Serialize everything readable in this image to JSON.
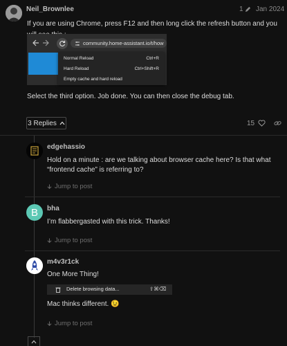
{
  "post": {
    "username": "Neil_Brownlee",
    "edit_count": "1",
    "date": "Jan 2024",
    "intro": "If you are using Chrome, press F12 and then long click the refresh button and you will see this :",
    "screenshot": {
      "url": "community.home-assistant.io/t/how",
      "menu": [
        {
          "label": "Normal Reload",
          "shortcut": "Ctrl+R"
        },
        {
          "label": "Hard Reload",
          "shortcut": "Ctrl+Shift+R"
        },
        {
          "label": "Empty cache and hard reload",
          "shortcut": ""
        }
      ]
    },
    "outro": "Select the third option. Job done. You can then close the debug tab.",
    "replies_label": "3 Replies",
    "likes": "15"
  },
  "replies": [
    {
      "username": "edgehassio",
      "text1": "Hold on a minute : are we talking about browser cache here? Is that what",
      "text2": "“frontend cache” is referring to?",
      "jump": "Jump to post"
    },
    {
      "username": "bha",
      "avatar_letter": "B",
      "avatar_color": "#5cc8b4",
      "text1": "I’m flabbergasted with this trick. Thanks!",
      "jump": "Jump to post"
    },
    {
      "username": "m4v3r1ck",
      "text1": "One More Thing!",
      "screenshot_label": "Delete browsing data...",
      "screenshot_shortcut": "⇧⌘⌫",
      "text2": "Mac thinks different. 😉",
      "jump": "Jump to post"
    }
  ]
}
